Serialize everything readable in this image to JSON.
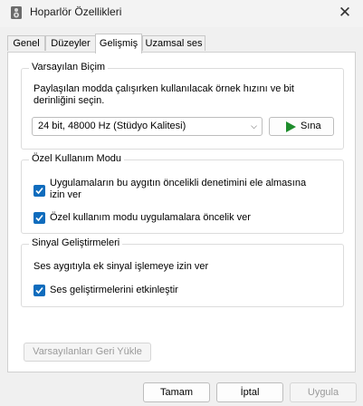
{
  "window": {
    "title": "Hoparlör Özellikleri",
    "close_icon": "✕"
  },
  "tabs": [
    {
      "label": "Genel",
      "active": false
    },
    {
      "label": "Düzeyler",
      "active": false
    },
    {
      "label": "Gelişmiş",
      "active": true
    },
    {
      "label": "Uzamsal ses",
      "active": false
    }
  ],
  "default_format": {
    "group_title": "Varsayılan Biçim",
    "description_line1": "Paylaşılan modda çalışırken kullanılacak örnek hızını ve bit",
    "description_line2": "derinliğini seçin.",
    "selected_format": "24 bit, 48000 Hz (Stüdyo Kalitesi)",
    "test_button_label": "Sına"
  },
  "exclusive_mode": {
    "group_title": "Özel Kullanım Modu",
    "option1_line1": "Uygulamaların bu aygıtın öncelikli denetimini ele almasına",
    "option1_line2": "izin ver",
    "option1_checked": true,
    "option2_label": "Özel kullanım modu uygulamalara öncelik ver",
    "option2_checked": true
  },
  "signal_enhancements": {
    "group_title": "Sinyal Geliştirmeleri",
    "description": "Ses aygıtıyla ek sinyal işlemeye izin ver",
    "option_label": "Ses geliştirmelerini etkinleştir",
    "option_checked": true
  },
  "restore_defaults_label": "Varsayılanları Geri Yükle",
  "footer": {
    "ok_label": "Tamam",
    "cancel_label": "İptal",
    "apply_label": "Uygula"
  },
  "colors": {
    "accent": "#0f6cbd",
    "play_icon": "#1e8c2c"
  }
}
